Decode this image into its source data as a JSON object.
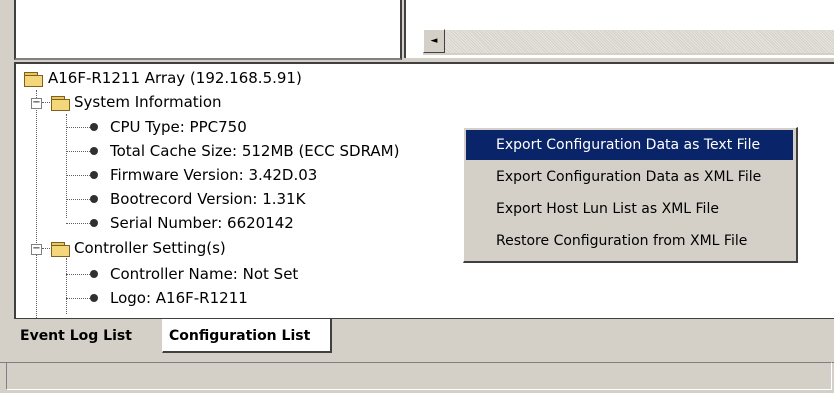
{
  "tree": {
    "root": {
      "label": "A16F-R1211 Array (192.168.5.91)"
    },
    "system_information": {
      "label": "System Information",
      "items": [
        "CPU Type: PPC750",
        "Total Cache Size: 512MB (ECC SDRAM)",
        "Firmware Version: 3.42D.03",
        "Bootrecord Version: 1.31K",
        "Serial Number: 6620142"
      ]
    },
    "controller_settings": {
      "label": "Controller Setting(s)",
      "items": [
        "Controller Name: Not Set",
        "Logo: A16F-R1211"
      ]
    },
    "expander_symbol": "−"
  },
  "tabs": {
    "event_log": "Event Log List",
    "configuration": "Configuration List"
  },
  "context_menu": {
    "items": [
      "Export Configuration Data as Text File",
      "Export Configuration Data as XML File",
      "Export Host Lun List as XML File",
      "Restore Configuration from XML File"
    ]
  },
  "scrollbar": {
    "left_arrow": "◄"
  },
  "colors": {
    "window_bg": "#d4d0c8",
    "menu_highlight": "#0a246a",
    "folder": "#f3d77a"
  }
}
